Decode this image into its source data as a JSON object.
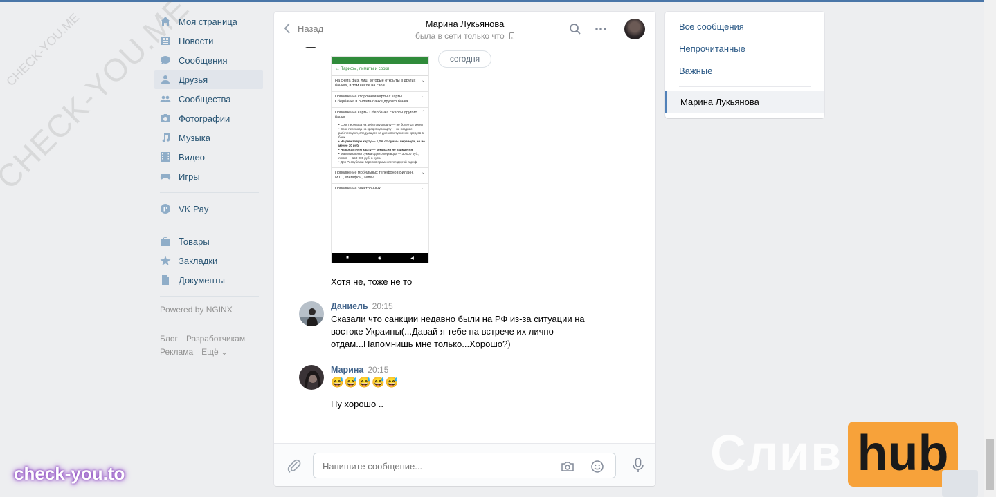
{
  "nav": {
    "items": [
      {
        "label": "Моя страница",
        "icon": "home-icon"
      },
      {
        "label": "Новости",
        "icon": "news-icon"
      },
      {
        "label": "Сообщения",
        "icon": "messages-icon"
      },
      {
        "label": "Друзья",
        "icon": "friends-icon"
      },
      {
        "label": "Сообщества",
        "icon": "groups-icon"
      },
      {
        "label": "Фотографии",
        "icon": "camera-icon"
      },
      {
        "label": "Музыка",
        "icon": "music-icon"
      },
      {
        "label": "Видео",
        "icon": "video-icon"
      },
      {
        "label": "Игры",
        "icon": "games-icon"
      }
    ],
    "vkpay": "VK Pay",
    "items2": [
      {
        "label": "Товары",
        "icon": "bag-icon"
      },
      {
        "label": "Закладки",
        "icon": "star-icon"
      },
      {
        "label": "Документы",
        "icon": "document-icon"
      }
    ],
    "powered": "Powered by NGINX",
    "links": [
      "Блог",
      "Разработчикам",
      "Реклама",
      "Ещё ⌄"
    ]
  },
  "chat": {
    "back_label": "Назад",
    "peer_name": "Марина Лукьянова",
    "peer_status": "была в сети только что",
    "date_divider": "сегодня",
    "screenshot": {
      "title": "Тарифы, лимиты и сроки",
      "rows": [
        "На счета физ. лиц, которые открыты в других банках, в том числе на свои",
        "Пополнение сторонней карты с карты Сбербанка в онлайн-банке другого банка",
        "Пополнение карты Сбербанка с карты другого банка"
      ],
      "bullets": [
        "Срок перевода на дебетовую карту — не более 15 минут",
        "Срок перевода на кредитную карту — не позднее рабочего дня, следующего за днем поступления средств в банк",
        "На дебетовую карту — 1,2% от суммы перевода, но не менее 30 руб.",
        "На кредитную карту — комиссия не взимается",
        "Максимальная сумма одного перевода — 30 000 руб., лимит — 150 000 руб. в сутки",
        "Для Республики Карелия применяется другой тариф"
      ],
      "row_last": "Пополнение мобильных телефонов Билайн, МТС, Мегафон, Теле2",
      "row_cut": "Пополнение электронных"
    },
    "text_after_image": "Хотя не, тоже не то",
    "messages": [
      {
        "author": "Даниель",
        "time": "20:15",
        "text": "Сказали что санкции недавно были на РФ из-за ситуации на востоке Украины(...Давай я тебе на встрече их лично отдам...Напомнишь мне только...Хорошо?)"
      },
      {
        "author": "Марина",
        "time": "20:15",
        "emoji": "😅😅😅😅😅",
        "text2": "Ну хорошо .."
      }
    ],
    "input_placeholder": "Напишите сообщение..."
  },
  "right": {
    "filters": [
      "Все сообщения",
      "Непрочитанные",
      "Важные"
    ],
    "conversation": "Марина Лукьянова"
  },
  "watermarks": {
    "diag_large": "CHECK-YOU.ME",
    "diag_small": "CHECK-YOU.ME",
    "bottom_left": "check-you.to",
    "brand_left": "Слив",
    "brand_right": "hub"
  },
  "colors": {
    "accent": "#4a76a8",
    "link": "#2a5885",
    "hub": "#f7a23a"
  }
}
